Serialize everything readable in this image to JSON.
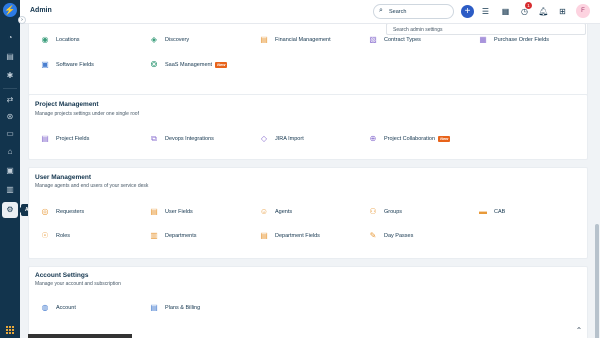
{
  "header": {
    "title": "Admin",
    "search_label": "Search",
    "notification_count": "1",
    "avatar_initial": "F"
  },
  "sidebar": {
    "tooltip": "Admin",
    "items": [
      {
        "icon": "dashboard-icon"
      },
      {
        "icon": "tickets-icon"
      },
      {
        "icon": "problems-icon"
      },
      {
        "icon": "changes-icon"
      },
      {
        "icon": "releases-icon"
      },
      {
        "icon": "assets-icon"
      },
      {
        "icon": "solutions-icon"
      },
      {
        "icon": "reports-icon"
      },
      {
        "icon": "admin-gear-icon"
      }
    ]
  },
  "admin_search": {
    "placeholder": "Search admin settings"
  },
  "top_row": {
    "items": [
      {
        "label": "Locations",
        "icon": "location-icon"
      },
      {
        "label": "Discovery",
        "icon": "discovery-icon"
      },
      {
        "label": "Financial Management",
        "icon": "finance-icon"
      },
      {
        "label": "Contract Types",
        "icon": "contract-icon"
      },
      {
        "label": "Purchase Order Fields",
        "icon": "purchase-icon"
      }
    ],
    "items2": [
      {
        "label": "Software Fields",
        "icon": "software-icon"
      },
      {
        "label": "SaaS Management",
        "icon": "saas-icon",
        "tag": "New"
      }
    ]
  },
  "project_management": {
    "title": "Project Management",
    "subtitle": "Manage projects settings under one single roof",
    "items": [
      {
        "label": "Project Fields",
        "icon": "project-fields-icon"
      },
      {
        "label": "Devops Integrations",
        "icon": "devops-icon"
      },
      {
        "label": "JIRA Import",
        "icon": "jira-icon"
      },
      {
        "label": "Project Collaboration",
        "icon": "collaboration-icon",
        "tag": "New"
      }
    ]
  },
  "user_management": {
    "title": "User Management",
    "subtitle": "Manage agents and end users of your service desk",
    "items": [
      {
        "label": "Requesters",
        "icon": "requester-icon"
      },
      {
        "label": "User Fields",
        "icon": "user-fields-icon"
      },
      {
        "label": "Agents",
        "icon": "agent-icon"
      },
      {
        "label": "Groups",
        "icon": "groups-icon"
      },
      {
        "label": "CAB",
        "icon": "cab-icon"
      },
      {
        "label": "Roles",
        "icon": "roles-icon"
      },
      {
        "label": "Departments",
        "icon": "departments-icon"
      },
      {
        "label": "Department Fields",
        "icon": "department-fields-icon"
      },
      {
        "label": "Day Passes",
        "icon": "day-pass-icon"
      }
    ]
  },
  "account_settings": {
    "title": "Account Settings",
    "subtitle": "Manage your account and subscription",
    "items": [
      {
        "label": "Account",
        "icon": "account-icon"
      },
      {
        "label": "Plans & Billing",
        "icon": "billing-icon"
      }
    ]
  },
  "colors": {
    "rail": "#12344d",
    "accent": "#2c5cc5",
    "new_tag": "#e8631a",
    "badge": "#d72d30"
  }
}
